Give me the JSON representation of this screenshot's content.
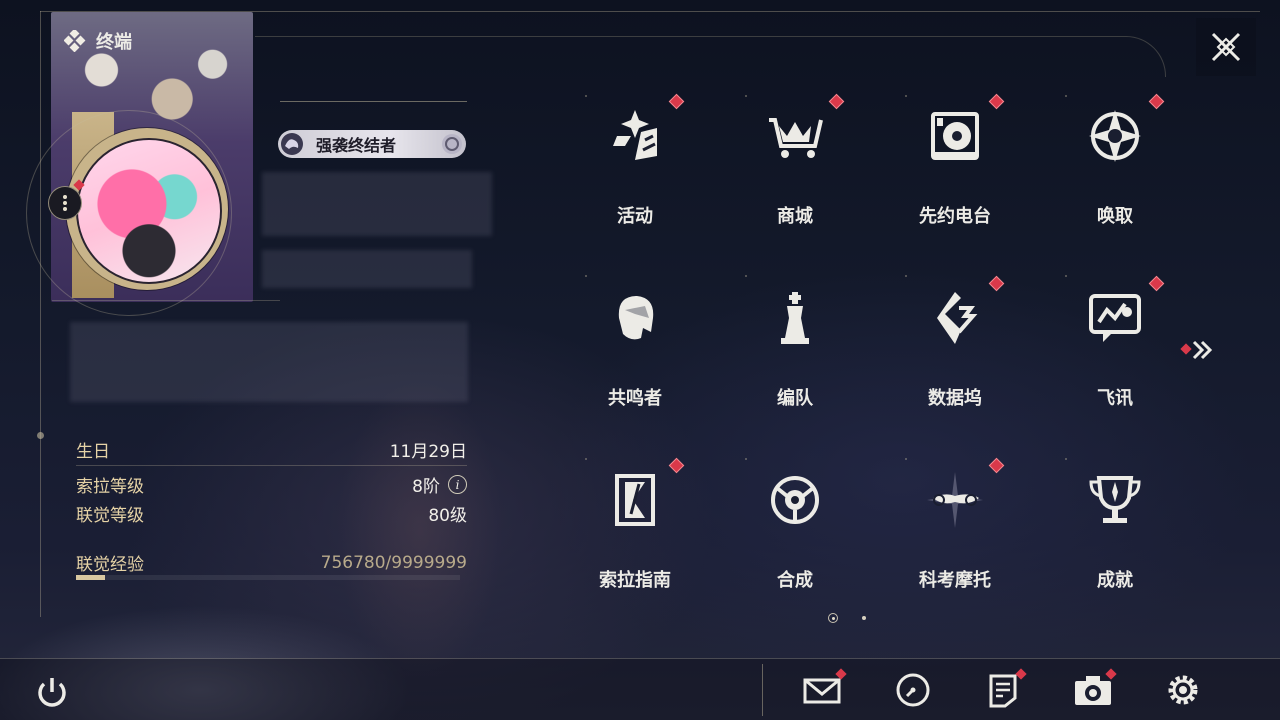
{
  "header": {
    "title": "终端"
  },
  "profile": {
    "title_badge": "强袭终结者",
    "stats": {
      "birthday_label": "生日",
      "birthday_value": "11月29日",
      "sola_level_label": "索拉等级",
      "sola_level_value": "8阶",
      "sola_level_info": "i",
      "union_level_label": "联觉等级",
      "union_level_value": "80级",
      "exp_label": "联觉经验",
      "exp_value": "756780/9999999",
      "exp_progress": 0.0757
    }
  },
  "menu": {
    "page_count": 2,
    "current_page": 1,
    "items": [
      {
        "label": "活动",
        "icon": "activity-icon",
        "badge": true
      },
      {
        "label": "商城",
        "icon": "shop-cart-icon",
        "badge": true
      },
      {
        "label": "先约电台",
        "icon": "radio-icon",
        "badge": true
      },
      {
        "label": "唤取",
        "icon": "compass-star-icon",
        "badge": true
      },
      {
        "label": "共鸣者",
        "icon": "resonator-icon",
        "badge": false
      },
      {
        "label": "编队",
        "icon": "chess-team-icon",
        "badge": false
      },
      {
        "label": "数据坞",
        "icon": "data-dock-icon",
        "badge": true
      },
      {
        "label": "飞讯",
        "icon": "chat-message-icon",
        "badge": true
      },
      {
        "label": "索拉指南",
        "icon": "guide-book-icon",
        "badge": true
      },
      {
        "label": "合成",
        "icon": "synthesis-icon",
        "badge": false
      },
      {
        "label": "科考摩托",
        "icon": "motorcycle-icon",
        "badge": true
      },
      {
        "label": "成就",
        "icon": "trophy-icon",
        "badge": false
      }
    ]
  },
  "bottom_bar": {
    "icons": [
      "power-icon",
      "mail-icon",
      "clock-icon",
      "notes-icon",
      "camera-icon",
      "settings-gear-icon"
    ]
  },
  "colors": {
    "accent_gold": "#e6d3a6",
    "badge_red": "#d9394a",
    "text_light": "#ecebe6"
  }
}
